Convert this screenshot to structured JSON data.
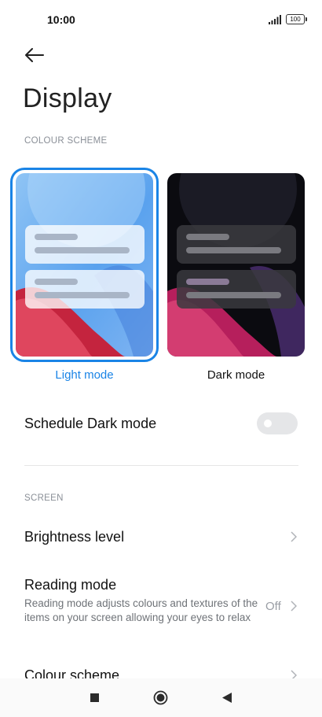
{
  "status_bar": {
    "time": "10:00",
    "battery": "100",
    "signal_icon": "signal-bars-icon"
  },
  "header": {
    "back_icon": "arrow-left-icon",
    "title": "Display"
  },
  "colour_scheme": {
    "section_label": "COLOUR SCHEME",
    "light": {
      "label": "Light mode",
      "selected": true
    },
    "dark": {
      "label": "Dark mode",
      "selected": false
    }
  },
  "schedule": {
    "label": "Schedule Dark mode",
    "enabled": false
  },
  "screen": {
    "section_label": "SCREEN",
    "brightness": {
      "label": "Brightness level"
    },
    "reading_mode": {
      "label": "Reading mode",
      "description": "Reading mode adjusts colours and textures of the items on your screen allowing your eyes to relax",
      "value": "Off"
    },
    "colour_scheme": {
      "label": "Colour scheme"
    }
  },
  "nav_bar": {
    "recents_icon": "square-icon",
    "home_icon": "circle-icon",
    "back_icon": "triangle-back-icon"
  },
  "colors": {
    "accent": "#1a84e6",
    "toggle_off": "#e5e6e8"
  }
}
